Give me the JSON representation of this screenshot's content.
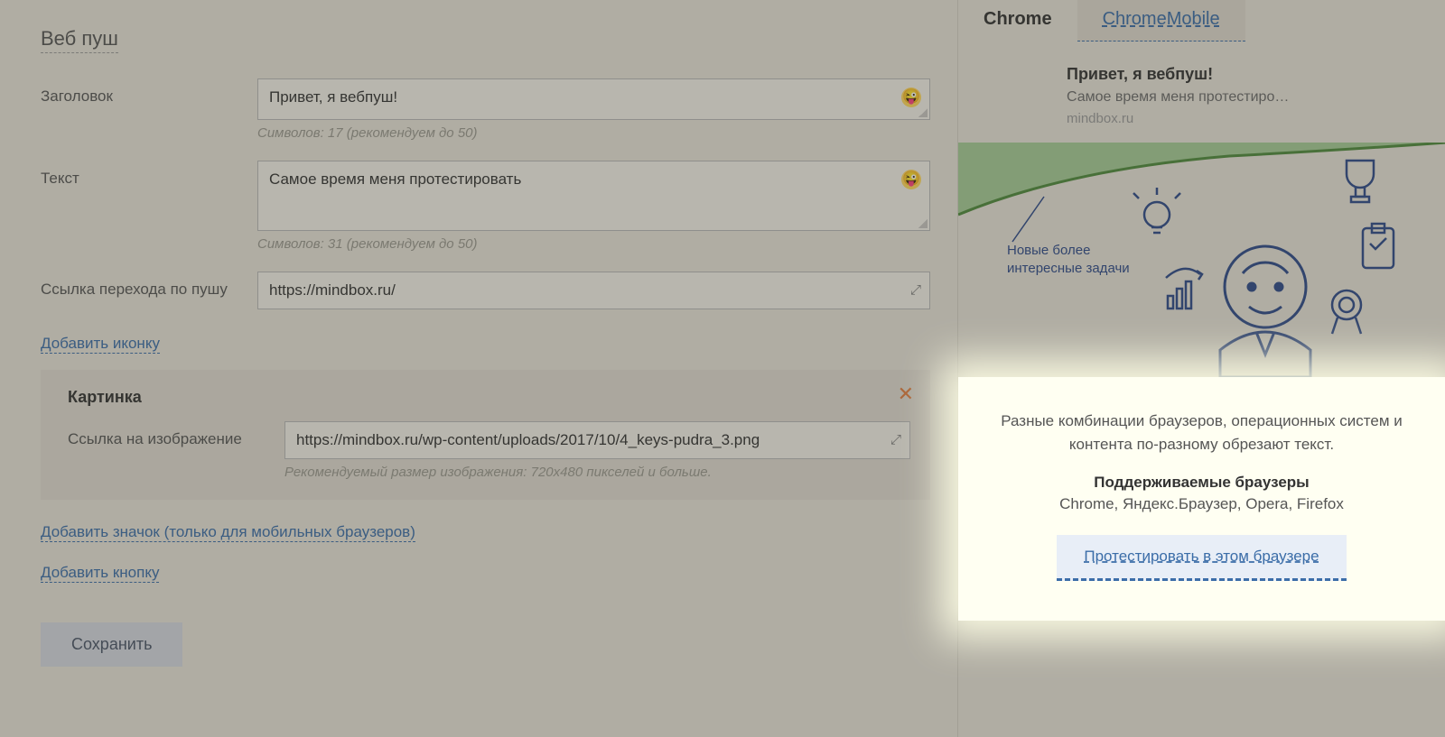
{
  "section_title": "Веб пуш",
  "form": {
    "title_label": "Заголовок",
    "title_value": "Привет, я вебпуш!",
    "title_helper": "Символов: 17 (рекомендуем до 50)",
    "text_label": "Текст",
    "text_value": "Самое время меня протестировать",
    "text_helper": "Символов: 31 (рекомендуем до 50)",
    "link_label": "Ссылка перехода по пушу",
    "link_value": "https://mindbox.ru/",
    "add_icon_link": "Добавить иконку",
    "image_panel": {
      "title": "Картинка",
      "url_label": "Ссылка на изображение",
      "url_value": "https://mindbox.ru/wp-content/uploads/2017/10/4_keys-pudra_3.png",
      "helper": "Рекомендуемый размер изображения: 720x480 пикселей и больше."
    },
    "add_badge_link": "Добавить значок (только для мобильных браузеров)",
    "add_button_link": "Добавить кнопку",
    "save_button": "Сохранить"
  },
  "preview": {
    "tabs": {
      "chrome": "Chrome",
      "chrome_mobile": "ChromeMobile"
    },
    "notif": {
      "title": "Привет, я вебпуш!",
      "body": "Самое время меня протестиро…",
      "domain": "mindbox.ru"
    },
    "illus_caption_1": "Новые более",
    "illus_caption_2": "интересные задачи",
    "info": {
      "text": "Разные комбинации браузеров, операционных систем и контента по-разному обрезают текст.",
      "supported_title": "Поддерживаемые браузеры",
      "supported_list": "Chrome, Яндекс.Браузер, Opera, Firefox",
      "test_button": "Протестировать в этом браузере"
    }
  }
}
